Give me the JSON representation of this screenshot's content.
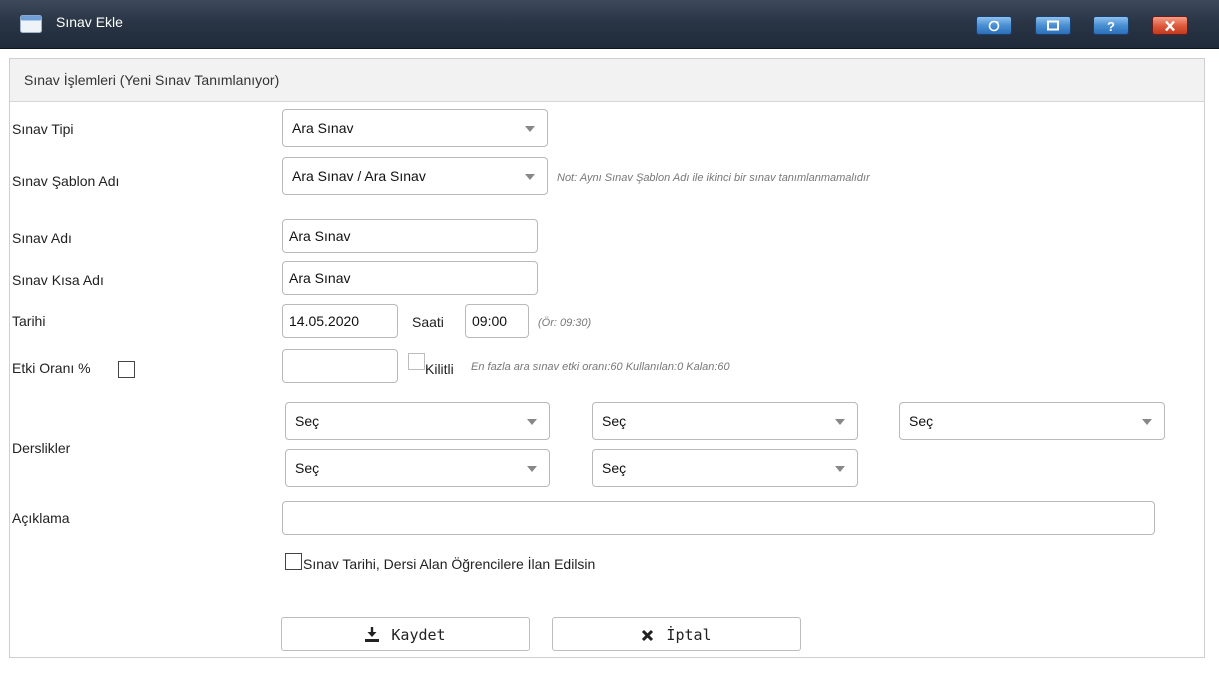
{
  "window": {
    "title": "Sınav Ekle",
    "controls": {
      "help_label": "?"
    }
  },
  "panel": {
    "title": "Sınav İşlemleri (Yeni Sınav Tanımlanıyor)"
  },
  "form": {
    "exam_type": {
      "label": "Sınav Tipi",
      "value": "Ara Sınav"
    },
    "template": {
      "label": "Sınav Şablon Adı",
      "value": "Ara Sınav / Ara Sınav",
      "note": "Not: Aynı Sınav Şablon Adı ile ikinci bir sınav tanımlanmamalıdır"
    },
    "exam_name": {
      "label": "Sınav Adı",
      "value": "Ara Sınav"
    },
    "exam_short_name": {
      "label": "Sınav Kısa Adı",
      "value": "Ara Sınav"
    },
    "date": {
      "label": "Tarihi",
      "value": "14.05.2020",
      "time_label": "Saati",
      "time_value": "09:00",
      "time_hint": "(Ör: 09:30)"
    },
    "effect": {
      "label": "Etki Oranı %",
      "value": "",
      "lock_label": "Kilitli",
      "info": "En fazla ara sınav etki oranı:60 Kullanılan:0 Kalan:60"
    },
    "classrooms": {
      "label": "Derslikler",
      "selects": [
        "Seç",
        "Seç",
        "Seç",
        "Seç",
        "Seç"
      ]
    },
    "description": {
      "label": "Açıklama",
      "value": ""
    },
    "announce": {
      "label": "Sınav Tarihi, Dersi Alan Öğrencilere İlan Edilsin",
      "checked": false
    }
  },
  "actions": {
    "save_label": "Kaydet",
    "cancel_label": "İptal"
  }
}
